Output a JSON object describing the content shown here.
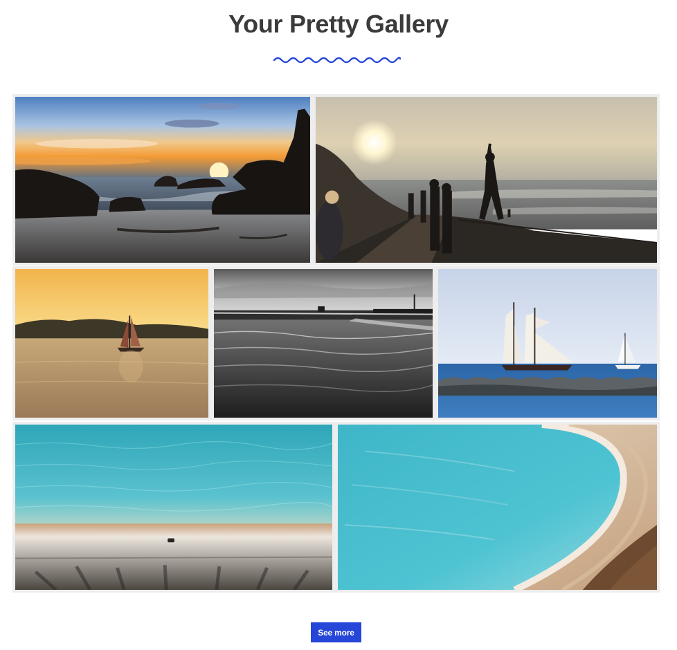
{
  "header": {
    "title": "Your Pretty Gallery"
  },
  "gallery": {
    "photos": [
      {
        "subject": "rocky beach sunset"
      },
      {
        "subject": "people on seaside promenade at sunset"
      },
      {
        "subject": "sailboat at golden hour"
      },
      {
        "subject": "black and white pier and water"
      },
      {
        "subject": "tall ships beside breakwater"
      },
      {
        "subject": "turquoise water and sandy shore"
      },
      {
        "subject": "curving turquoise lagoon"
      }
    ]
  },
  "footer": {
    "see_more_label": "See more"
  },
  "colors": {
    "accent": "#2546d8",
    "title": "#3b3b3b",
    "tile_border": "#ededed"
  }
}
